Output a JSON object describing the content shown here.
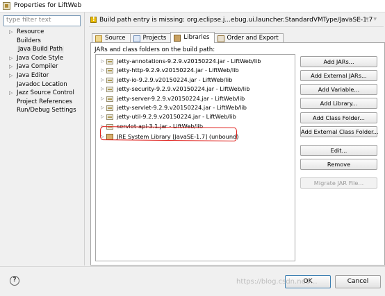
{
  "window": {
    "title": "Properties for LiftWeb"
  },
  "filter": {
    "placeholder": "type filter text"
  },
  "nav": {
    "items": [
      {
        "label": "Resource",
        "expandable": true
      },
      {
        "label": "Builders",
        "expandable": false
      },
      {
        "label": "Java Build Path",
        "expandable": false,
        "selected": true
      },
      {
        "label": "Java Code Style",
        "expandable": true
      },
      {
        "label": "Java Compiler",
        "expandable": true
      },
      {
        "label": "Java Editor",
        "expandable": true
      },
      {
        "label": "Javadoc Location",
        "expandable": false
      },
      {
        "label": "Jazz Source Control",
        "expandable": true
      },
      {
        "label": "Project References",
        "expandable": false
      },
      {
        "label": "Run/Debug Settings",
        "expandable": false
      }
    ]
  },
  "header": {
    "message": "Build path entry is missing: org.eclipse.j...ebug.ui.launcher.StandardVMType/JavaSE-1.7",
    "nav_buttons": "⇦ ▾ ⇨ ▾ ▾"
  },
  "tabs": [
    {
      "label": "Source",
      "icon": "source-folder-icon"
    },
    {
      "label": "Projects",
      "icon": "projects-icon"
    },
    {
      "label": "Libraries",
      "icon": "libraries-icon",
      "active": true
    },
    {
      "label": "Order and Export",
      "icon": "order-export-icon"
    }
  ],
  "libraries": {
    "caption": "JARs and class folders on the build path:",
    "jars": [
      "jetty-annotations-9.2.9.v20150224.jar - LiftWeb/lib",
      "jetty-http-9.2.9.v20150224.jar - LiftWeb/lib",
      "jetty-io-9.2.9.v20150224.jar - LiftWeb/lib",
      "jetty-security-9.2.9.v20150224.jar - LiftWeb/lib",
      "jetty-server-9.2.9.v20150224.jar - LiftWeb/lib",
      "jetty-servlet-9.2.9.v20150224.jar - LiftWeb/lib",
      "jetty-util-9.2.9.v20150224.jar - LiftWeb/lib",
      "servlet-api-3.1.jar - LiftWeb/lib"
    ],
    "jre": "JRE System Library [JavaSE-1.7] (unbound)"
  },
  "buttons": {
    "add_jars": "Add JARs...",
    "add_external_jars": "Add External JARs...",
    "add_variable": "Add Variable...",
    "add_library": "Add Library...",
    "add_class_folder": "Add Class Folder...",
    "add_external_class_folder": "Add External Class Folder...",
    "edit": "Edit...",
    "remove": "Remove",
    "migrate_jar": "Migrate JAR File..."
  },
  "footer": {
    "help": "?",
    "ok": "OK",
    "cancel": "Cancel",
    "watermark": "https://blog.csdn.net/..."
  },
  "colors": {
    "annotation_red": "#e0201c",
    "focus_blue": "#3c7fb1"
  }
}
